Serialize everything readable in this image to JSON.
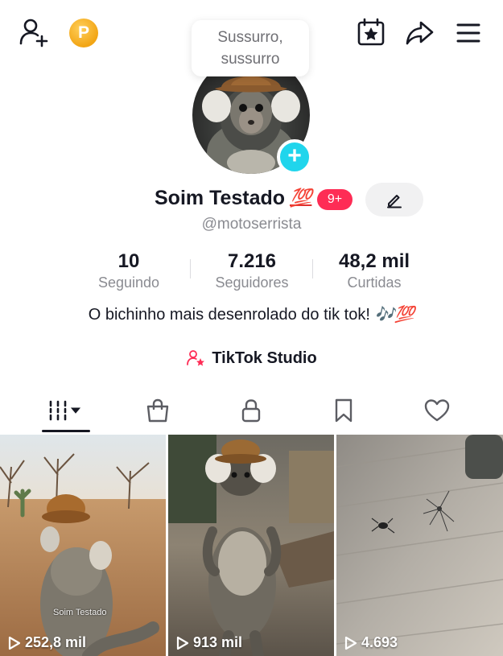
{
  "bubble": {
    "text": "Sussurro, sussurro"
  },
  "coin": {
    "letter": "P"
  },
  "profile": {
    "display_name": "Soim Testado",
    "name_emoji": "💯",
    "badge": "9+",
    "username": "@motoserrista"
  },
  "stats": [
    {
      "value": "10",
      "label": "Seguindo"
    },
    {
      "value": "7.216",
      "label": "Seguidores"
    },
    {
      "value": "48,2 mil",
      "label": "Curtidas"
    }
  ],
  "bio": {
    "text": "O bichinho mais desenrolado do tik tok! ",
    "emoji": "🎶💯"
  },
  "studio": {
    "label": "TikTok Studio"
  },
  "tabs": [
    {
      "icon": "videos-grid-icon"
    },
    {
      "icon": "shopping-bag-icon"
    },
    {
      "icon": "lock-icon"
    },
    {
      "icon": "bookmark-icon"
    },
    {
      "icon": "heart-icon"
    }
  ],
  "videos": [
    {
      "views": "252,8 mil",
      "watermark": "Soim Testado"
    },
    {
      "views": "913 mil"
    },
    {
      "views": "4.693"
    }
  ],
  "colors": {
    "accent": "#fe2c55",
    "plus": "#20d5ec",
    "coin": "#f2a515"
  }
}
